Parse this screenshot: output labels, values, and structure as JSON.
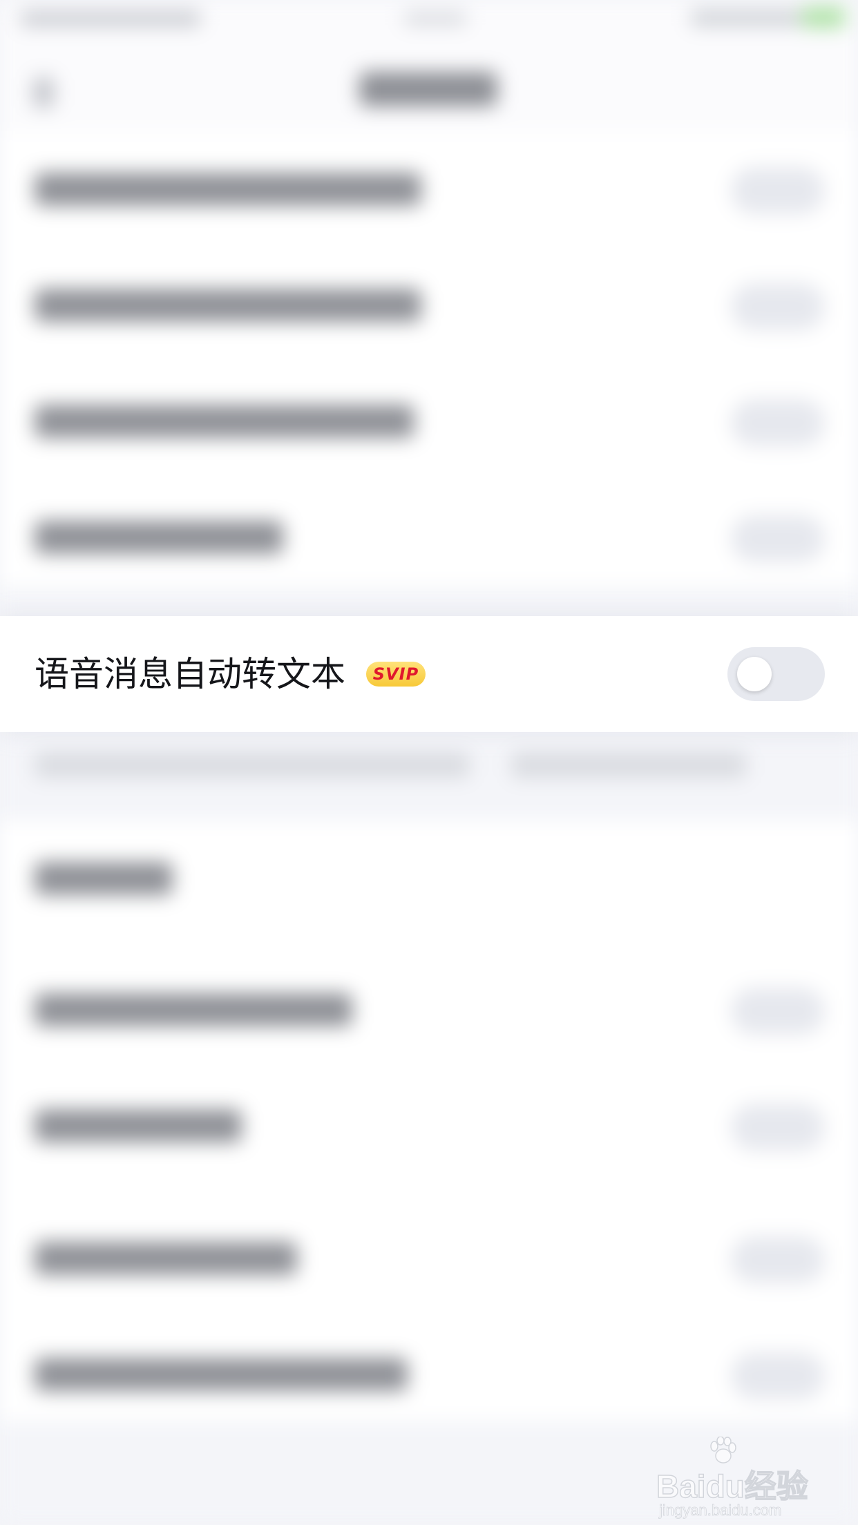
{
  "setting": {
    "label": "语音消息自动转文本",
    "badge": "SVIP",
    "toggle_on": false
  },
  "watermark": {
    "brand": "Baidu经验",
    "url": "jingyan.baidu.com"
  },
  "colors": {
    "badge_gold": "#f7c938",
    "badge_text": "#e0182d",
    "toggle_off": "#e7e9ef",
    "background": "#f3f4f8"
  }
}
